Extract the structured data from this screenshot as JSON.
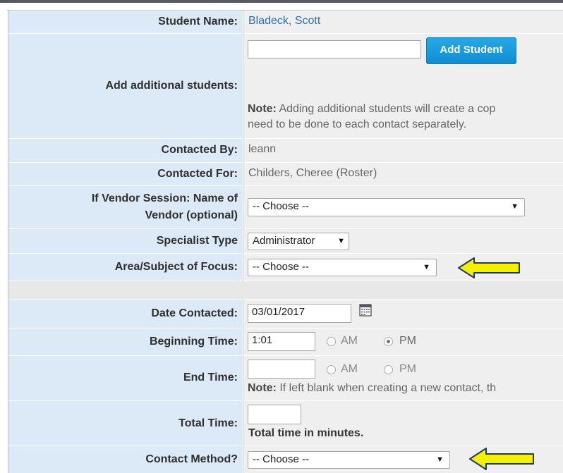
{
  "rows": {
    "student_name": {
      "label": "Student Name:",
      "value": "Bladeck, Scott"
    },
    "add_students": {
      "label": "Add additional students:",
      "input_value": "",
      "button": "Add Student",
      "note_label": "Note:",
      "note_line1": "Adding additional students will create a cop",
      "note_line2": "need to be done to each contact separately."
    },
    "contacted_by": {
      "label": "Contacted By:",
      "value": "leann"
    },
    "contacted_for": {
      "label": "Contacted For:",
      "value": "Childers, Cheree (Roster)"
    },
    "vendor": {
      "label_line1": "If Vendor Session: Name of",
      "label_line2": "Vendor (optional)",
      "selected": "-- Choose --"
    },
    "specialist": {
      "label": "Specialist Type",
      "selected": "Administrator"
    },
    "focus": {
      "label": "Area/Subject of Focus:",
      "selected": "-- Choose --"
    },
    "date": {
      "label": "Date Contacted:",
      "value": "03/01/2017"
    },
    "begin": {
      "label": "Beginning Time:",
      "value": "1:01",
      "am": "AM",
      "pm": "PM",
      "selected": "PM"
    },
    "end": {
      "label": "End Time:",
      "value": "",
      "am": "AM",
      "pm": "PM",
      "note_label": "Note:",
      "note_text": "If left blank when creating a new contact, th"
    },
    "total": {
      "label": "Total Time:",
      "value": "",
      "hint": "Total time in minutes."
    },
    "method": {
      "label": "Contact Method?",
      "selected": "-- Choose --"
    }
  },
  "icons": {
    "dropdown": "triangle-down-icon",
    "calendar": "calendar-icon",
    "pointer": "yellow-arrow-icon"
  },
  "colors": {
    "label_bg": "#dce9f7",
    "value_bg": "#efefef",
    "button_blue": "#1a9bdc",
    "link_blue": "#2e6db4",
    "arrow_yellow": "#f4f000"
  }
}
